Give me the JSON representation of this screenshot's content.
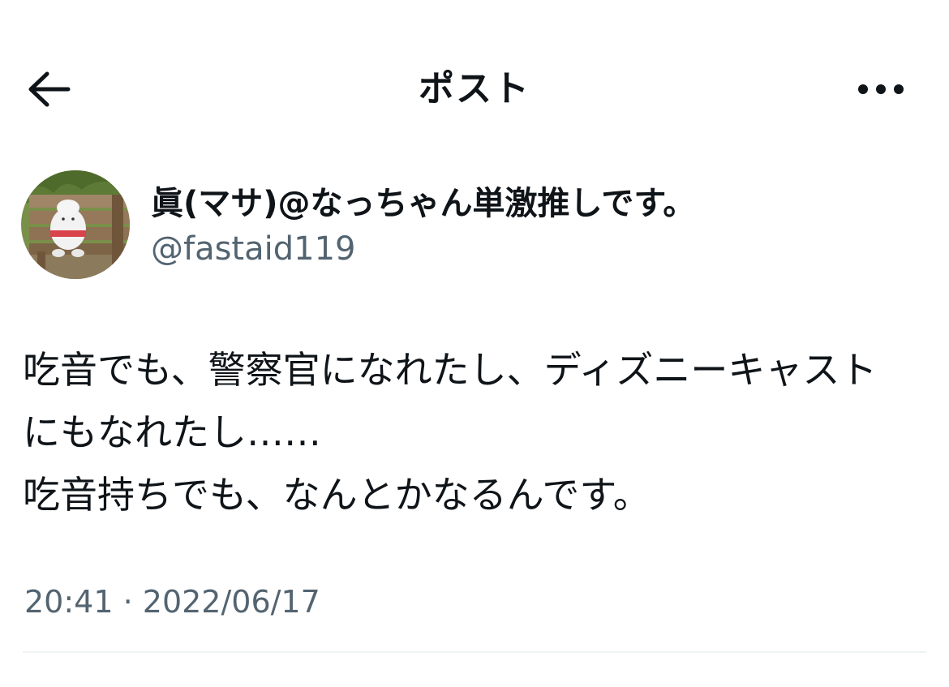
{
  "header": {
    "title": "ポスト",
    "back_icon": "arrow-left-icon",
    "more_icon": "more-horizontal-icon"
  },
  "author": {
    "display_name": "眞(マサ)@なっちゃん単激推しです。",
    "handle": "@fastaid119"
  },
  "post": {
    "lines": [
      "吃音でも、警察官になれたし、ディズニーキャスト",
      "にもなれたし……",
      "吃音持ちでも、なんとかなるんです。"
    ]
  },
  "meta": {
    "time": "20:41",
    "separator": " · ",
    "date": "2022/06/17"
  },
  "colors": {
    "text": "#0f1419",
    "secondary_text": "#536471",
    "divider": "#eff3f4",
    "background": "#ffffff"
  }
}
